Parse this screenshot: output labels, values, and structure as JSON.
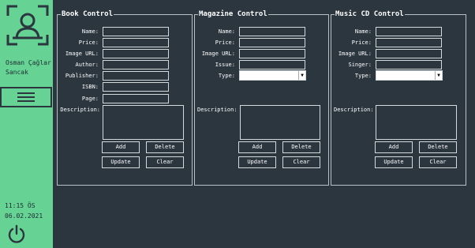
{
  "user": {
    "name": "Osman Çağlar Sancak"
  },
  "clock": {
    "time": "11:15 ÖS",
    "date": "06.02.2021"
  },
  "icons": {
    "avatar": "user-scan-icon",
    "menu": "hamburger-menu-icon",
    "power": "power-icon"
  },
  "book": {
    "title": "Book Control",
    "labels": {
      "name": "Name:",
      "price": "Price:",
      "image_url": "Image URL:",
      "author": "Author:",
      "publisher": "Publisher:",
      "isbn": "ISBN:",
      "page": "Page:",
      "description": "Description:"
    },
    "buttons": {
      "add": "Add",
      "delete": "Delete",
      "update": "Update",
      "clear": "Clear"
    }
  },
  "magazine": {
    "title": "Magazine Control",
    "labels": {
      "name": "Name:",
      "price": "Price:",
      "image_url": "Image URL:",
      "issue": "Issue:",
      "type": "Type:",
      "description": "Description:"
    },
    "buttons": {
      "add": "Add",
      "delete": "Delete",
      "update": "Update",
      "clear": "Clear"
    }
  },
  "musiccd": {
    "title": "Music CD Control",
    "labels": {
      "name": "Name:",
      "price": "Price:",
      "image_url": "Image URL:",
      "singer": "Singer:",
      "type": "Type:",
      "description": "Description:"
    },
    "buttons": {
      "add": "Add",
      "delete": "Delete",
      "update": "Update",
      "clear": "Clear"
    }
  },
  "colors": {
    "sidebar": "#66d394",
    "background": "#2b363f",
    "dark_text": "#1e2a32"
  }
}
